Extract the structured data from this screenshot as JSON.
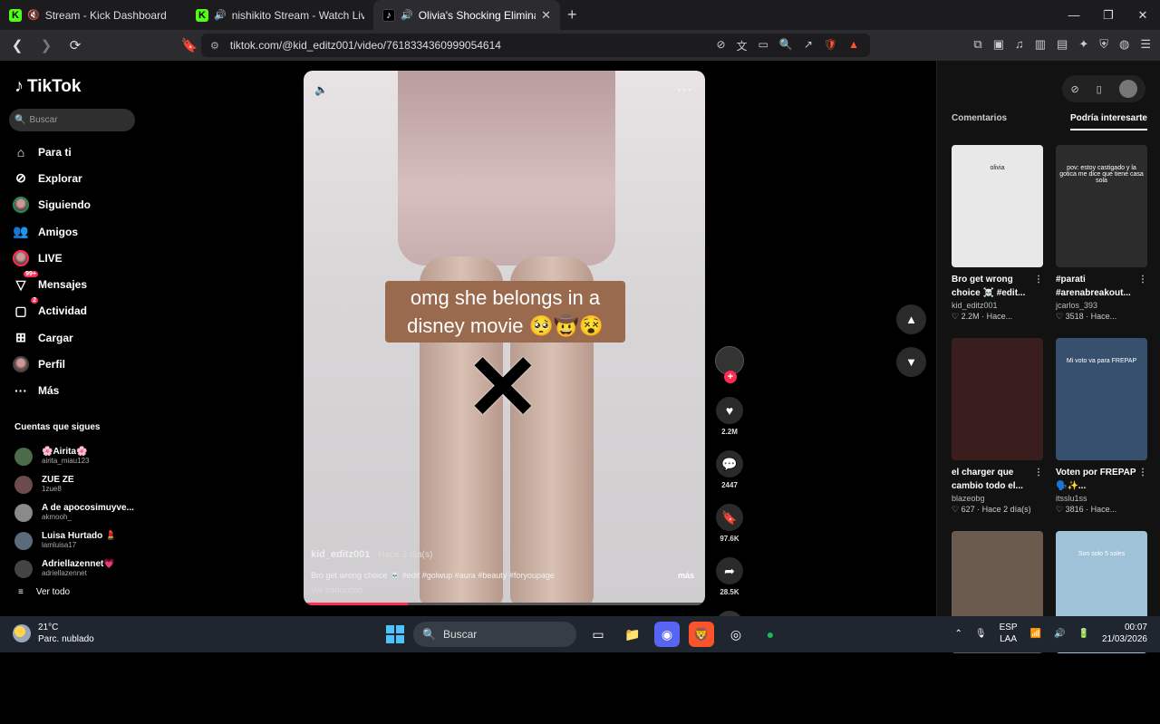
{
  "browser": {
    "tabs": [
      {
        "label": "Stream - Kick Dashboard",
        "icon": "kick-icon",
        "active": false
      },
      {
        "label": "nishikito Stream - Watch Live on Kick",
        "icon": "kick-icon",
        "active": false
      },
      {
        "label": "Olivia's Shocking Elimination",
        "icon": "tiktok-icon",
        "active": true
      }
    ],
    "new_tab": "+",
    "url": "tiktok.com/@kid_editz001/video/7618334360999054614"
  },
  "tiktok": {
    "logo": "TikTok",
    "search_placeholder": "Buscar",
    "menu": [
      {
        "label": "Para ti",
        "icon": "home-icon"
      },
      {
        "label": "Explorar",
        "icon": "compass-icon"
      },
      {
        "label": "Siguiendo",
        "icon": "following-avatar"
      },
      {
        "label": "Amigos",
        "icon": "friends-icon"
      },
      {
        "label": "LIVE",
        "icon": "live-avatar"
      },
      {
        "label": "Mensajes",
        "icon": "messages-icon",
        "badge": "99+"
      },
      {
        "label": "Actividad",
        "icon": "activity-icon",
        "badge": "2"
      },
      {
        "label": "Cargar",
        "icon": "upload-icon"
      },
      {
        "label": "Perfil",
        "icon": "profile-avatar"
      },
      {
        "label": "Más",
        "icon": "more-icon"
      }
    ],
    "following_header": "Cuentas que sigues",
    "following": [
      {
        "name": "🌸Airita🌸",
        "handle": "airita_miau123"
      },
      {
        "name": "ZUE ZE",
        "handle": "1zue8"
      },
      {
        "name": "A de apocosimuyve...",
        "handle": "akmooh_"
      },
      {
        "name": "Luisa Hurtado 💄",
        "handle": "lamluisa17"
      },
      {
        "name": "Adriellazennet💗",
        "handle": "adriellazennet"
      }
    ],
    "see_all": "Ver todo"
  },
  "video": {
    "caption_line1": "omg she belongs in a",
    "caption_line2": "disney movie 🥺🤠😵",
    "username": "kid_editz001",
    "when": "· Hace 3 día(s)",
    "description": "Bro get wrong choice ☠️ #edit #golwup #aura #beauty #foryoupage",
    "more": "más",
    "translate": "Ver traducción",
    "progress": 0.26,
    "likes": "2.2M",
    "comments": "2447",
    "saves": "97.6K",
    "shares": "28.5K"
  },
  "right_panel": {
    "tab_comments": "Comentarios",
    "tab_suggested": "Podría interesarte",
    "cards": [
      {
        "title": "Bro get wrong choice ☠️ #edit...",
        "user": "kid_editz001",
        "stat": "♡ 2.2M · Hace...",
        "color": "#e8e8e8",
        "thumb_text": "olivia"
      },
      {
        "title": "#parati #arenabreakout...",
        "user": "jcarlos_393",
        "stat": "♡ 3518 · Hace...",
        "color": "#2c2c2c",
        "thumb_text": "pov: estoy castigado y la gotica me dice que tiene casa sola"
      },
      {
        "title": "el charger que cambio todo el...",
        "user": "blazeobg",
        "stat": "♡ 627 · Hace 2 día(s)",
        "color": "#3a1e1e",
        "thumb_text": ""
      },
      {
        "title": "Voten por FREPAP 🗣️✨...",
        "user": "itsslu1ss",
        "stat": "♡ 3816 · Hace...",
        "color": "#36506e",
        "thumb_text": "Mi voto va para FREPAP"
      },
      {
        "title": "",
        "user": "",
        "stat": "",
        "color": "#6b5a4e",
        "thumb_text": ""
      },
      {
        "title": "",
        "user": "",
        "stat": "",
        "color": "#9fc2d8",
        "thumb_text": "Son solo 5 soles"
      }
    ]
  },
  "taskbar": {
    "temp": "21°C",
    "weather": "Parc. nublado",
    "search": "Buscar",
    "lang1": "ESP",
    "lang2": "LAA",
    "time": "00:07",
    "date": "21/03/2026"
  }
}
